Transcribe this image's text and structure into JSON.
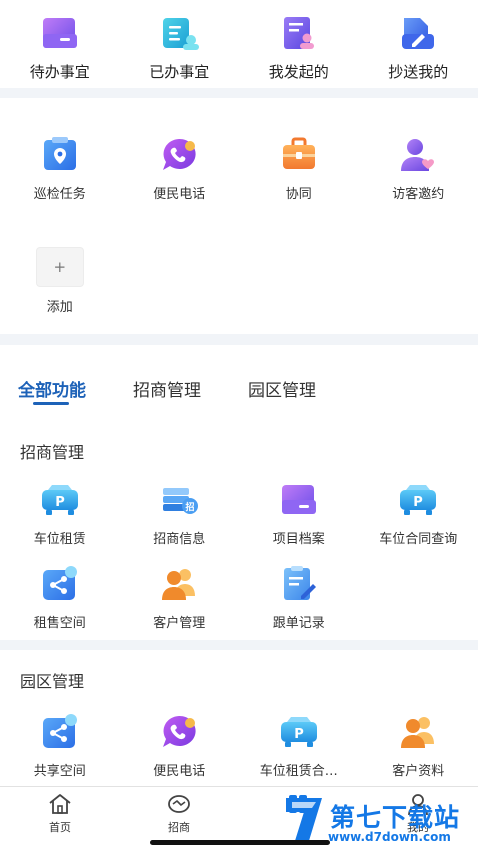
{
  "quick_actions": [
    {
      "label": "待办事宜",
      "icon": "todo-folder-icon",
      "color": "#8a5cf6"
    },
    {
      "label": "已办事宜",
      "icon": "done-doc-icon",
      "color": "#22b5d6"
    },
    {
      "label": "我发起的",
      "icon": "initiated-doc-icon",
      "color": "#7c5cf0"
    },
    {
      "label": "抄送我的",
      "icon": "cc-edit-icon",
      "color": "#3b6ff0"
    }
  ],
  "common_apps": [
    {
      "label": "巡检任务",
      "icon": "patrol-map-icon"
    },
    {
      "label": "便民电话",
      "icon": "phone-icon"
    },
    {
      "label": "协同",
      "icon": "briefcase-icon"
    },
    {
      "label": "访客邀约",
      "icon": "visitor-icon"
    }
  ],
  "add_button": {
    "symbol": "+",
    "label": "添加"
  },
  "tabs": [
    {
      "label": "全部功能",
      "active": true
    },
    {
      "label": "招商管理",
      "active": false
    },
    {
      "label": "园区管理",
      "active": false
    }
  ],
  "section_investment": {
    "title": "招商管理",
    "items": [
      {
        "label": "车位租赁",
        "icon": "parking-car-icon"
      },
      {
        "label": "招商信息",
        "icon": "investment-books-icon"
      },
      {
        "label": "项目档案",
        "icon": "project-folder-icon"
      },
      {
        "label": "车位合同查询",
        "icon": "parking-contract-icon"
      },
      {
        "label": "租售空间",
        "icon": "share-space-icon"
      },
      {
        "label": "客户管理",
        "icon": "customer-group-icon"
      },
      {
        "label": "跟单记录",
        "icon": "follow-record-icon"
      }
    ]
  },
  "section_park": {
    "title": "园区管理",
    "items": [
      {
        "label": "共享空间",
        "icon": "share-space-icon"
      },
      {
        "label": "便民电话",
        "icon": "phone-icon"
      },
      {
        "label": "车位租赁合…",
        "icon": "parking-car-icon"
      },
      {
        "label": "客户资料",
        "icon": "customer-group-icon"
      }
    ]
  },
  "bottom_nav": [
    {
      "label": "首页",
      "icon": "home-icon"
    },
    {
      "label": "招商",
      "icon": "investment-icon"
    },
    {
      "label": "",
      "icon": "apps-icon"
    },
    {
      "label": "我的",
      "icon": "user-icon"
    }
  ],
  "watermark": {
    "name": "第七下载站",
    "url": "www.d7down.com"
  },
  "colors": {
    "accent": "#1d62b8",
    "background": "#f1f4f8"
  }
}
